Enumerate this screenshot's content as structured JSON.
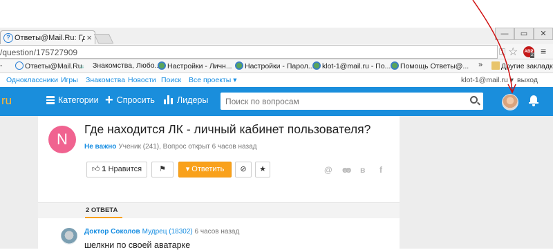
{
  "browser": {
    "tab_title": "Ответы@Mail.Ru: Где нах",
    "tab_close": "×",
    "url": "/question/175727909",
    "window_buttons": [
      "—",
      "▭",
      "✕"
    ],
    "bookmarks": [
      {
        "label": "Ответы@Mail.Ru",
        "icon": "answers-icon"
      },
      {
        "label": "Знакомства, Любо...",
        "icon": "fish-icon"
      },
      {
        "label": "Настройки - Личн...",
        "icon": "globe-icon"
      },
      {
        "label": "Настройки - Парол...",
        "icon": "globe-icon"
      },
      {
        "label": "klot-1@mail.ru - По...",
        "icon": "globe-icon"
      },
      {
        "label": "Помощь Ответы@...",
        "icon": "globe-icon"
      }
    ],
    "bookmarks_more": "»",
    "other_bookmarks": "Другие закладки",
    "abp_label": "ABP",
    "abp_badge": "2"
  },
  "portal": {
    "links": [
      "Одноклассники",
      "Игры",
      "Знакомства",
      "Новости",
      "Поиск",
      "Все проекты ▾"
    ],
    "user_email": "klot-1@mail.ru ▾",
    "logout": "выход"
  },
  "header": {
    "logo_fragment": "ru",
    "categories": "Категории",
    "ask": "Спросить",
    "leaders": "Лидеры",
    "search_placeholder": "Поиск по вопросам"
  },
  "question": {
    "avatar_letter": "N",
    "title": "Где находится ЛК - личный кабинет пользователя?",
    "author": "Не важно",
    "meta": "Ученик (241), Вопрос открыт 6 часов назад",
    "like_count": "1",
    "like_label": "Нравится",
    "answer_label": "Ответить"
  },
  "share_icons": [
    "@",
    "ok",
    "в",
    "f"
  ],
  "answers": {
    "count_label": "2 ОТВЕТА",
    "items": [
      {
        "author": "Доктор Соколов",
        "rank": "Мудрец (18302)",
        "time": "6 часов назад",
        "text": "шелкни по своей аватарке"
      }
    ]
  },
  "colors": {
    "header_bg": "#1a8edc",
    "accent_orange": "#f9a11b",
    "link_blue": "#168de2",
    "question_avatar": "#f06390",
    "annotation_red": "#d01010"
  }
}
